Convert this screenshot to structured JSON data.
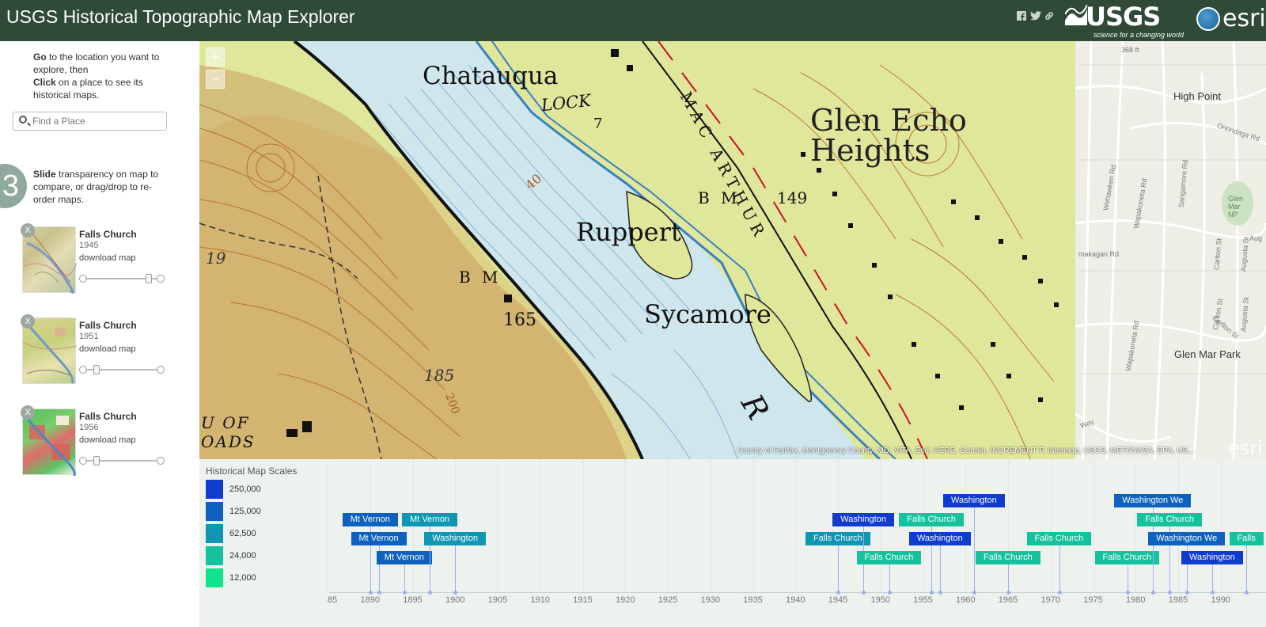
{
  "header": {
    "title": "USGS Historical Topographic Map Explorer",
    "usgs_logo": "USGS",
    "usgs_tagline": "science for a changing world",
    "esri_logo": "esri"
  },
  "sidebar": {
    "step1_go": "Go",
    "step1_go_rest": " to the location you want to explore, then",
    "step2_click": "Click",
    "step2_click_rest": " on a place to see its historical maps.",
    "search_placeholder": "Find a Place",
    "step_number": "3",
    "step3_slide": "Slide",
    "step3_rest": " transparency on map to compare, or drag/drop to re-order maps.",
    "maps": [
      {
        "name": "Falls Church",
        "year": "1945",
        "download": "download map",
        "close": "X",
        "opacity": 0.88
      },
      {
        "name": "Falls Church",
        "year": "1951",
        "download": "download map",
        "close": "X",
        "opacity": 0.1
      },
      {
        "name": "Falls Church",
        "year": "1956",
        "download": "download map",
        "close": "X",
        "opacity": 0.1
      }
    ]
  },
  "map": {
    "zoom_in": "+",
    "zoom_out": "−",
    "topo_labels": {
      "chatauqua": "Chatauqua",
      "lock": "LOCK",
      "lock_num": "7",
      "macarthur": "MAC ARTHUR",
      "glen_echo": "Glen Echo",
      "heights": "Heights",
      "bm149": "B M",
      "bm149_num": "149",
      "ruppert": "Ruppert",
      "sycamore": "Sycamore",
      "bm165": "B M",
      "bm165_num": "165",
      "n185": "185",
      "n200": "200",
      "n40": "40",
      "n19": "19",
      "u_of": "U OF",
      "oads": "OADS",
      "r": "R"
    },
    "base_labels": {
      "high_point": "High Point",
      "glen_mar_park": "Glen Mar Park",
      "glen_mar_np": "Glen Mar NP",
      "onondaga": "Onondaga Rd",
      "wehawken": "Wehawken Rd",
      "wapakoneta": "Wapakoneta Rd",
      "sangamore": "Sangamore Rd",
      "makagan": "makagan Rd",
      "carlton": "Carlton St",
      "augusta": "Augusta St",
      "n368": "368 ft",
      "arizona": "Aug",
      "way": "Way"
    },
    "attribution": "County of Fairfax, Montgomery County, MD, VITA, Esri, HERE, Garmin, INCREMENT P, Intermap, USGS, METI/NASA, EPA, US...",
    "esri_watermark": "esri"
  },
  "timeline": {
    "scales_title": "Historical Map Scales",
    "scales": [
      {
        "label": "250,000",
        "color": "#0f3ccf"
      },
      {
        "label": "125,000",
        "color": "#0e62be"
      },
      {
        "label": "62,500",
        "color": "#0f96b3"
      },
      {
        "label": "24,000",
        "color": "#16c29d"
      },
      {
        "label": "12,000",
        "color": "#12e48c"
      }
    ],
    "axis_years": [
      "85",
      "1890",
      "1895",
      "1900",
      "1905",
      "1910",
      "1915",
      "1920",
      "1925",
      "1930",
      "1935",
      "1940",
      "1945",
      "1950",
      "1955",
      "1960",
      "1965",
      "1970",
      "1975",
      "1980",
      "1985",
      "1990"
    ],
    "maps": [
      {
        "label": "Mt Vernon",
        "year": 1890,
        "scale": "125,000",
        "row": 0
      },
      {
        "label": "Mt Vernon",
        "year": 1891,
        "scale": "125,000",
        "row": 1
      },
      {
        "label": "Mt Vernon",
        "year": 1894,
        "scale": "125,000",
        "row": 2
      },
      {
        "label": "Mt Vernon",
        "year": 1897,
        "scale": "62,500",
        "row": 0
      },
      {
        "label": "Washington",
        "year": 1900,
        "scale": "62,500",
        "row": 1
      },
      {
        "label": "Falls Church",
        "year": 1945,
        "scale": "62,500",
        "row": 1
      },
      {
        "label": "Washington",
        "year": 1948,
        "scale": "250,000",
        "row": 0
      },
      {
        "label": "Falls Church",
        "year": 1951,
        "scale": "24,000",
        "row": 2
      },
      {
        "label": "Falls Church",
        "year": 1956,
        "scale": "24,000",
        "row": 0
      },
      {
        "label": "Washington",
        "year": 1957,
        "scale": "250,000",
        "row": 1
      },
      {
        "label": "Washington",
        "year": 1961,
        "scale": "250,000",
        "row": -1
      },
      {
        "label": "Falls Church",
        "year": 1965,
        "scale": "24,000",
        "row": 2
      },
      {
        "label": "Falls Church",
        "year": 1971,
        "scale": "24,000",
        "row": 1
      },
      {
        "label": "Falls Church",
        "year": 1979,
        "scale": "24,000",
        "row": 2
      },
      {
        "label": "Washington We",
        "year": 1982,
        "scale": "125,000",
        "row": -1
      },
      {
        "label": "Falls Church",
        "year": 1984,
        "scale": "24,000",
        "row": 0
      },
      {
        "label": "Washington We",
        "year": 1986,
        "scale": "125,000",
        "row": 1
      },
      {
        "label": "Washington",
        "year": 1989,
        "scale": "250,000",
        "row": 2
      },
      {
        "label": "Falls",
        "year": 1993,
        "scale": "24,000",
        "row": 1
      }
    ]
  }
}
